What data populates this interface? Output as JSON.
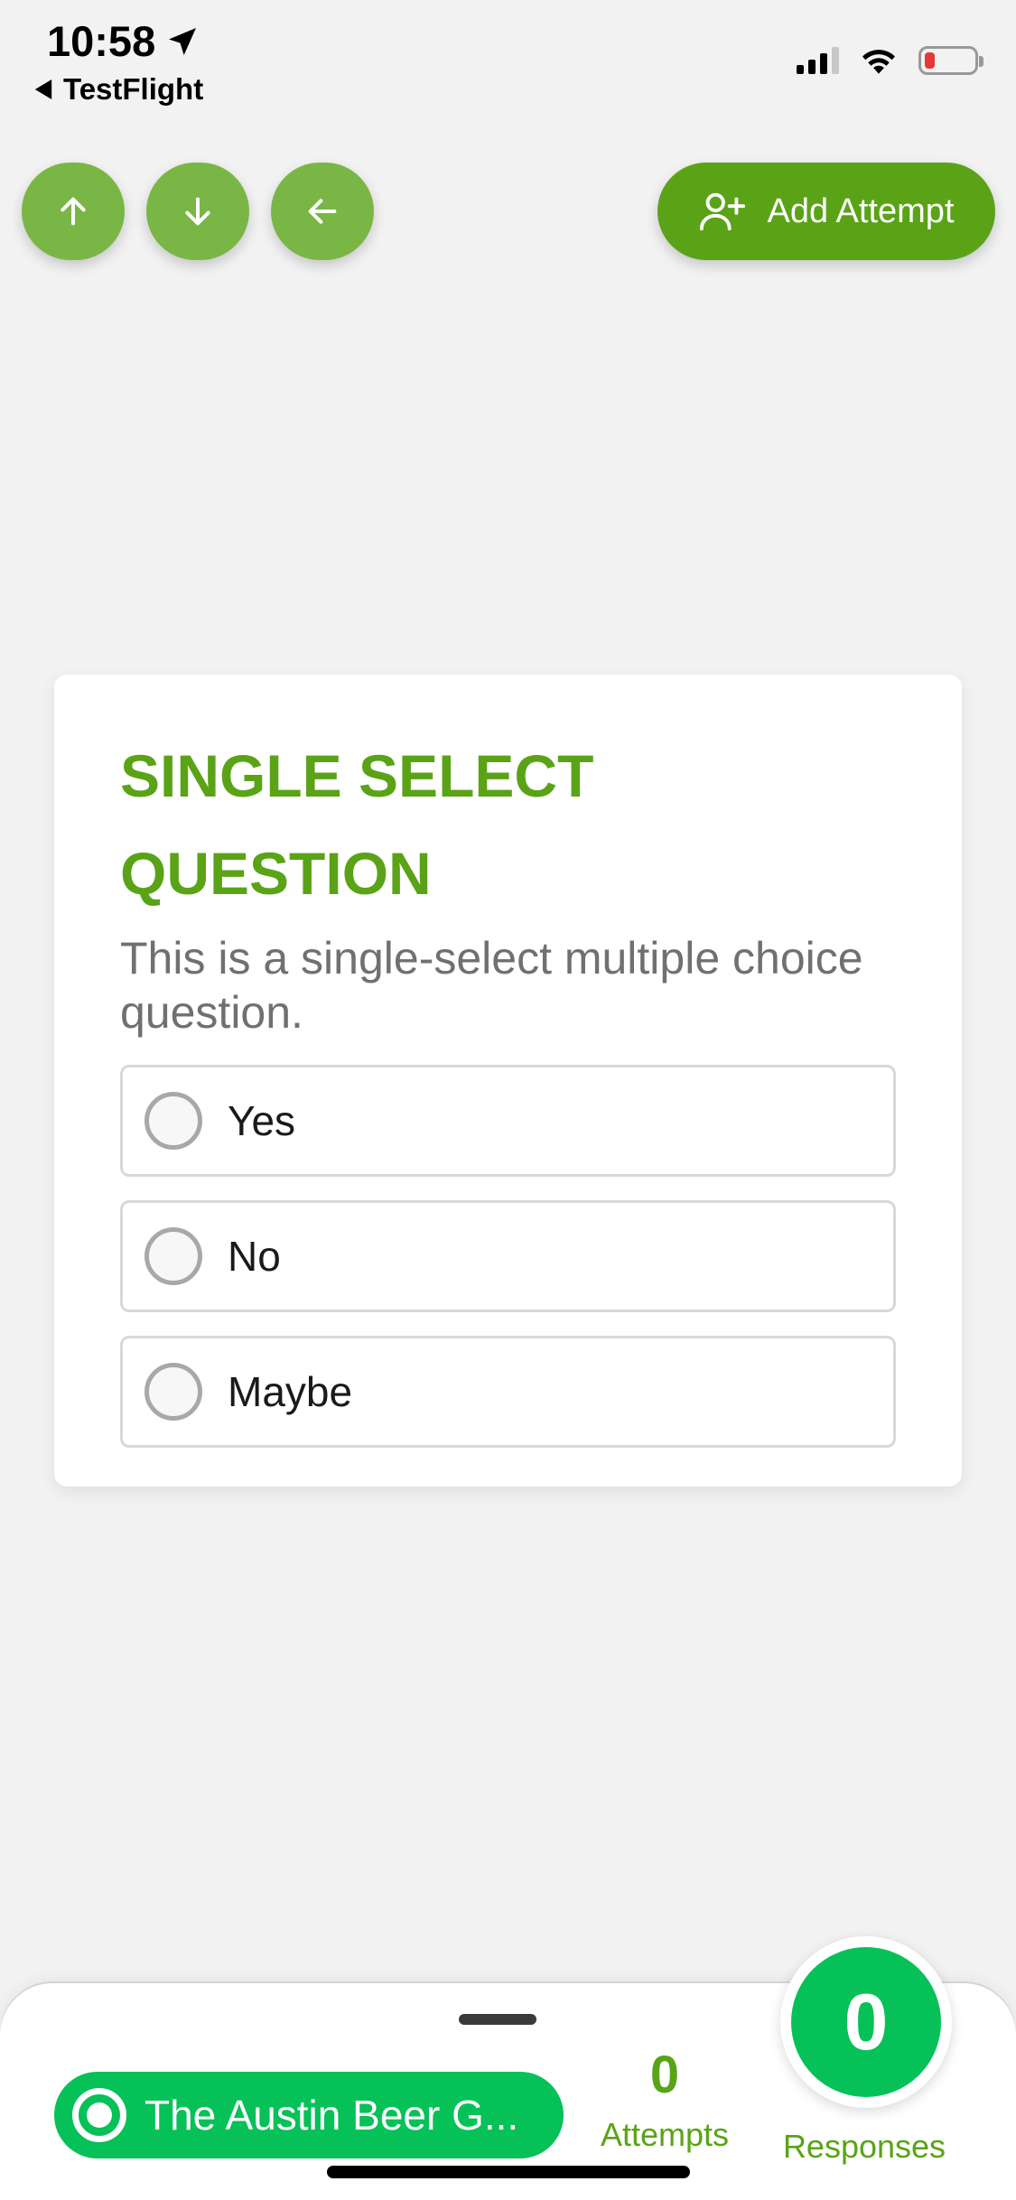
{
  "status_bar": {
    "time": "10:58",
    "back_label": "TestFlight",
    "battery_color": "#e53935"
  },
  "controls": {
    "up_icon": "arrow-up-icon",
    "down_icon": "arrow-down-icon",
    "back_icon": "arrow-left-icon",
    "add_attempt_label": "Add Attempt"
  },
  "question": {
    "title": "SINGLE SELECT QUESTION",
    "description": "This is a single-select multiple choice question.",
    "options": [
      {
        "label": "Yes",
        "selected": false
      },
      {
        "label": "No",
        "selected": false
      },
      {
        "label": "Maybe",
        "selected": false
      }
    ]
  },
  "bottom_sheet": {
    "location_label": "The Austin Beer G...",
    "attempts_count": "0",
    "attempts_label": "Attempts",
    "responses_count": "0",
    "responses_label": "Responses"
  },
  "colors": {
    "accent": "#5aa317",
    "light_accent": "#7ab645",
    "green_pill": "#06c158",
    "background": "#f2f2f2"
  }
}
